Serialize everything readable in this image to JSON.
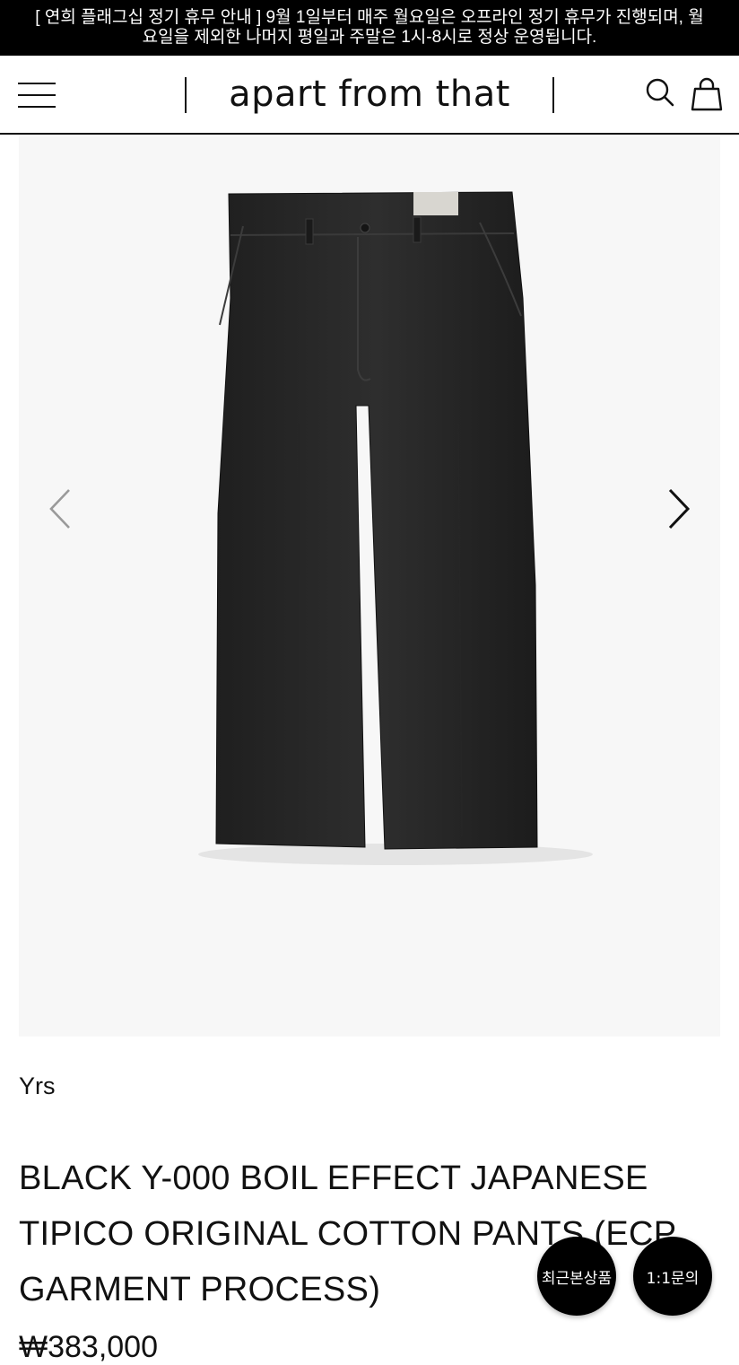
{
  "notice": {
    "line1": "[ 연희 플래그십 정기 휴무 안내 ] 9월 1일부터 매주 월요일은 오프라인 정기 휴무가 진행되며, 월",
    "line2": "요일을 제외한 나머지 평일과 주말은 1시-8시로 정상 운영됩니다."
  },
  "header": {
    "logo": "apart from that",
    "icons": {
      "menu": "hamburger-menu-icon",
      "search": "search-icon",
      "cart": "shopping-bag-icon"
    }
  },
  "gallery": {
    "image_alt": "black wide chino pants",
    "prev_icon": "chevron-left-icon",
    "next_icon": "chevron-right-icon"
  },
  "product": {
    "brand": "Yrs",
    "title_lines": [
      "BLACK Y-000 BOIL EFFECT JAPANESE",
      "TIPICO ORIGINAL COTTON PANTS (ECP",
      "GARMENT PROCESS)"
    ],
    "price": "₩383,000"
  },
  "floating": {
    "recent_label": "최근본상품",
    "inquiry_label": "1:1문의"
  },
  "colors": {
    "notice_bg": "#000000",
    "text": "#111111",
    "gallery_bg": "#f7f7f7",
    "pants": "#2a2a2a"
  }
}
